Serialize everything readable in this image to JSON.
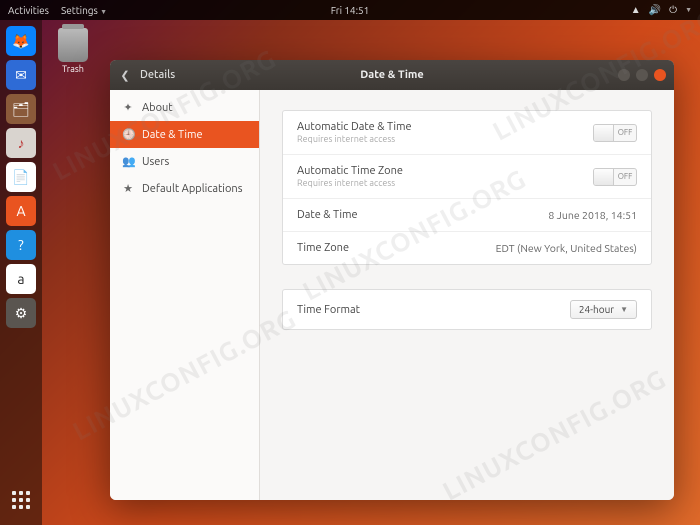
{
  "topbar": {
    "activities": "Activities",
    "app_menu": "Settings",
    "clock": "Fri 14:51"
  },
  "desktop": {
    "trash_label": "Trash"
  },
  "dock": {
    "items": [
      "firefox",
      "thunderbird",
      "files",
      "rhythmbox",
      "writer",
      "software",
      "help",
      "amazon",
      "settings"
    ]
  },
  "window": {
    "section": "Details",
    "title": "Date & Time",
    "sidebar": [
      {
        "icon": "✦",
        "label": "About"
      },
      {
        "icon": "🕘",
        "label": "Date & Time"
      },
      {
        "icon": "👥",
        "label": "Users"
      },
      {
        "icon": "★",
        "label": "Default Applications"
      }
    ],
    "active_index": 1,
    "settings": {
      "auto_datetime_label": "Automatic Date & Time",
      "auto_datetime_sub": "Requires internet access",
      "auto_datetime_state": "OFF",
      "auto_tz_label": "Automatic Time Zone",
      "auto_tz_sub": "Requires internet access",
      "auto_tz_state": "OFF",
      "datetime_label": "Date & Time",
      "datetime_value": "8 June 2018, 14:51",
      "tz_label": "Time Zone",
      "tz_value": "EDT (New York, United States)",
      "format_label": "Time Format",
      "format_value": "24-hour"
    }
  },
  "watermark": "LINUXCONFIG.ORG"
}
